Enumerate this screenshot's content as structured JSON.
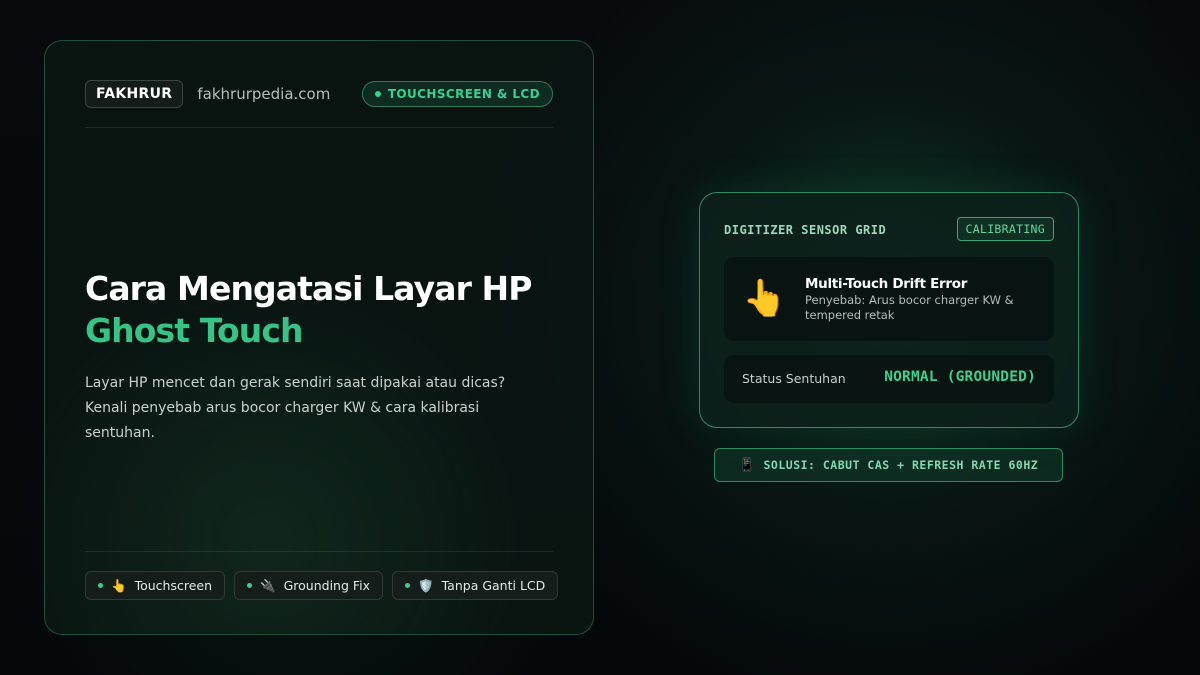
{
  "brand": {
    "name": "FAKHRUR",
    "site": "fakhrurpedia.com"
  },
  "topic_badge": "TOUCHSCREEN & LCD",
  "title": {
    "line1": "Cara Mengatasi Layar HP",
    "line2": "Ghost Touch"
  },
  "description": "Layar HP mencet dan gerak sendiri saat dipakai atau dicas? Kenali penyebab arus bocor charger KW & cara kalibrasi sentuhan.",
  "tags": [
    {
      "icon": "👆",
      "icon_name": "pointing-hand-icon",
      "label": "Touchscreen"
    },
    {
      "icon": "🔌",
      "icon_name": "plug-icon",
      "label": "Grounding Fix"
    },
    {
      "icon": "🛡️",
      "icon_name": "shield-icon",
      "label": "Tanpa Ganti LCD"
    }
  ],
  "panel": {
    "title": "DIGITIZER SENSOR GRID",
    "badge": "CALIBRATING",
    "error": {
      "icon": "👆",
      "icon_name": "pointing-hand-icon",
      "title": "Multi-Touch Drift Error",
      "cause": "Penyebab: Arus bocor charger KW & tempered retak"
    },
    "status": {
      "label": "Status Sentuhan",
      "value": "NORMAL (GROUNDED)"
    }
  },
  "solution": {
    "icon": "📱",
    "icon_name": "phone-icon",
    "text": "SOLUSI: CABUT CAS + REFRESH RATE 60HZ"
  },
  "colors": {
    "accent": "#36c486",
    "background": "#05080a",
    "card": "#0a1612"
  }
}
